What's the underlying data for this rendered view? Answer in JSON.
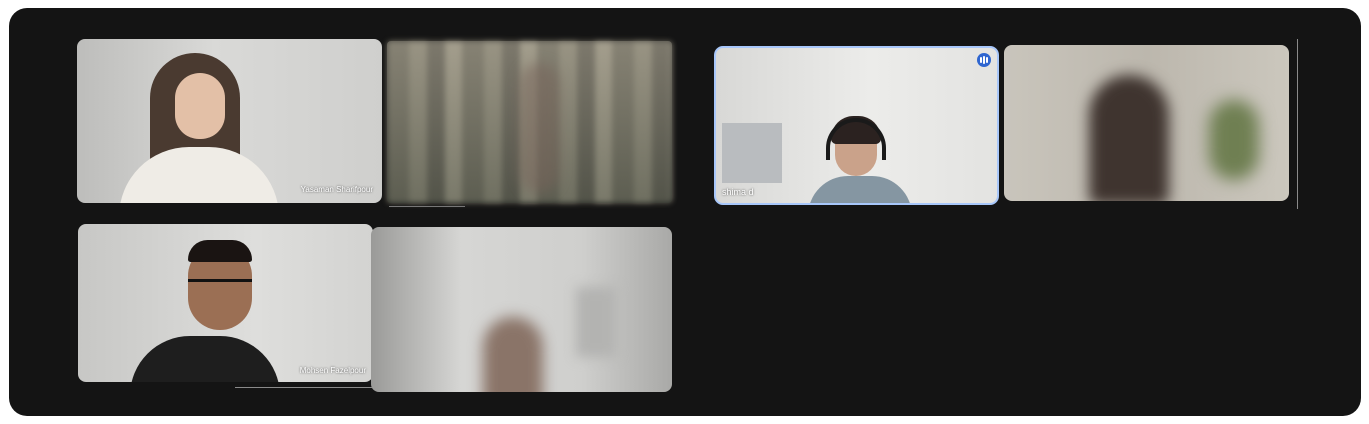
{
  "participants": [
    {
      "name": "Yasaman Sharifpour",
      "speaking": false
    },
    {
      "name": "",
      "speaking": false
    },
    {
      "name": "shima d",
      "speaking": true
    },
    {
      "name": "",
      "speaking": false
    },
    {
      "name": "Mohsen Fazelpour",
      "speaking": false
    },
    {
      "name": "",
      "speaking": false
    }
  ],
  "colors": {
    "background": "#141414",
    "active_border": "#a8c7fa",
    "speaking_badge": "#2f66d0"
  },
  "icons": {
    "speaking": "audio-level-icon"
  }
}
